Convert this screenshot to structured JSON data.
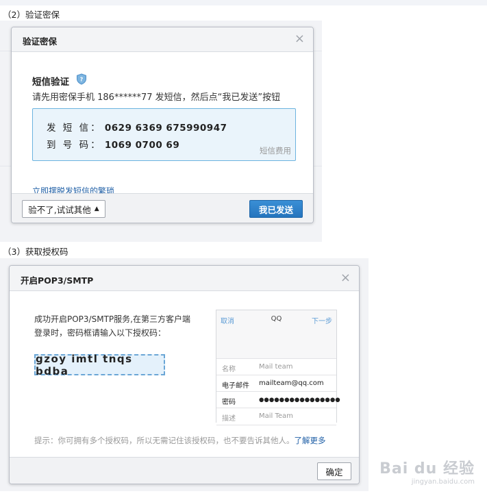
{
  "step2": {
    "label": "（2）验证密保",
    "dialog": {
      "title": "验证密保",
      "close": "×",
      "heading": "短信验证",
      "instruction": "请先用密保手机 186******77 发短信，然后点“我已发送”按钮",
      "sms_label": "发 短 信：",
      "sms_content": "0629 6369 675990947",
      "to_label": "到 号 码：",
      "to_number": "1069 0700 69",
      "fee_note": "短信费用",
      "link": "立即摆脱发短信的繁琐",
      "alt_button": "验不了,试试其他",
      "sent_button": "我已发送"
    }
  },
  "step3": {
    "label": "（3）获取授权码",
    "dialog": {
      "title": "开启POP3/SMTP",
      "close": "×",
      "success_line1": "成功开启POP3/SMTP服务,在第三方客户端",
      "success_line2": "登录时，密码框请输入以下授权码：",
      "auth_code": "gzoy imtl tnqs bdba",
      "phone": {
        "cancel": "取消",
        "title": "QQ",
        "next": "下一步",
        "rows": [
          {
            "key": "名称",
            "value": "Mail team"
          },
          {
            "key": "电子邮件",
            "value": "mailteam@qq.com"
          },
          {
            "key": "密码",
            "value": "●●●●●●●●●●●●●●●●"
          },
          {
            "key": "描述",
            "value": "Mail Team"
          }
        ]
      },
      "tip": "提示：你可拥有多个授权码，所以无需记住该授权码，也不要告诉其他人。",
      "learn_more": "了解更多",
      "ok_button": "确定"
    }
  },
  "watermark": {
    "logo": "Bai du 经验",
    "url": "jingyan.baidu.com"
  },
  "colors": {
    "primary_blue": "#2574bd",
    "link_blue": "#1f5fa6",
    "box_blue_border": "#6bb3df"
  }
}
